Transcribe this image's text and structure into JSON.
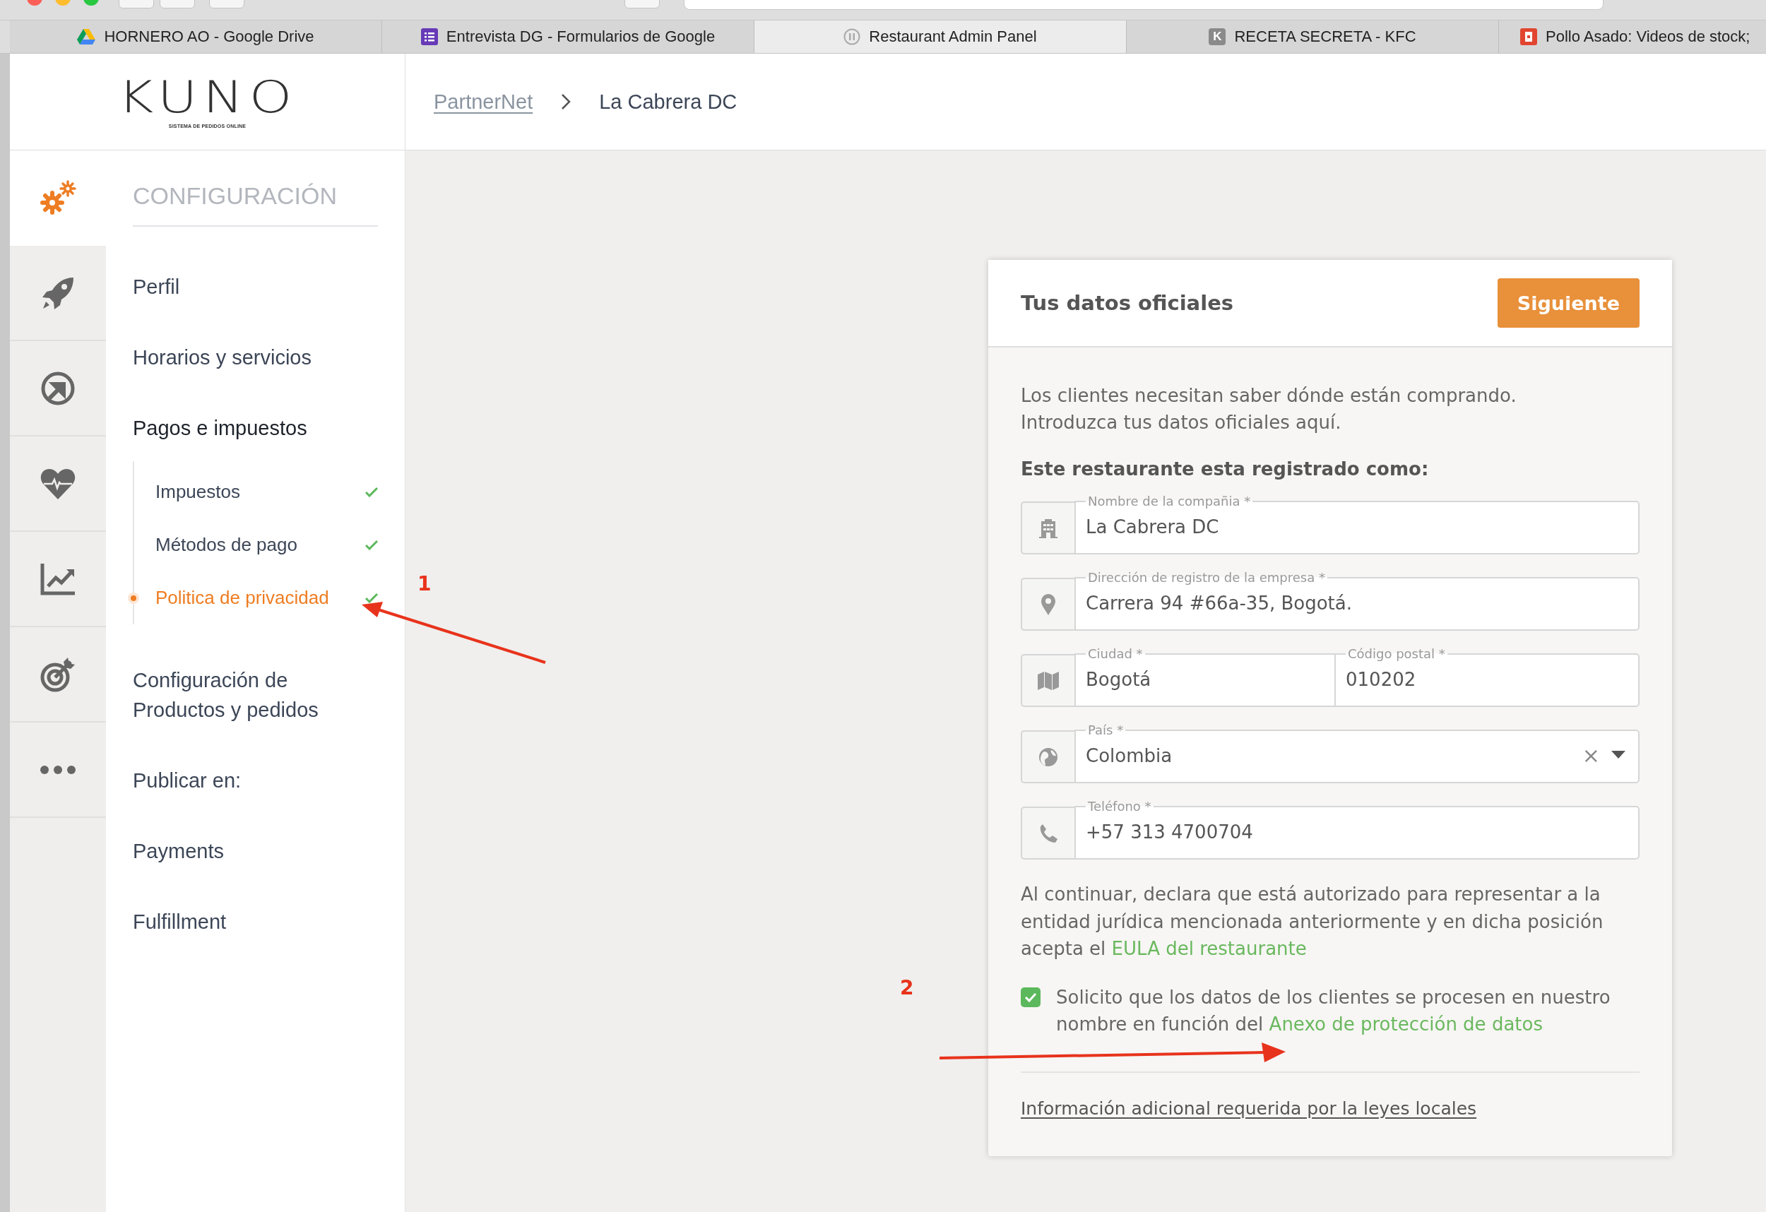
{
  "browser_tabs": [
    {
      "title": "HORNERO AO - Google Drive",
      "kind": "drive",
      "selected": false
    },
    {
      "title": "Entrevista DG - Formularios de Google",
      "kind": "forms",
      "selected": false
    },
    {
      "title": "Restaurant Admin Panel",
      "kind": "pause",
      "selected": true
    },
    {
      "title": "RECETA SECRETA - KFC",
      "kind": "letter",
      "badge": "K",
      "selected": false
    },
    {
      "title": "Pollo Asado: Videos de stock;",
      "kind": "square",
      "selected": false
    }
  ],
  "header": {
    "logo": {
      "wordmark": "KUNO",
      "tagline": "SISTEMA DE PEDIDOS ONLINE"
    },
    "breadcrumb": [
      {
        "label": "PartnerNet",
        "kind": "link"
      },
      {
        "label": "La Cabrera DC",
        "kind": "current"
      }
    ]
  },
  "icon_rail": [
    {
      "kind": "gears",
      "selected": true
    },
    {
      "kind": "rocket",
      "selected": false
    },
    {
      "kind": "arrow-circle",
      "selected": false
    },
    {
      "kind": "heart",
      "selected": false
    },
    {
      "kind": "chart",
      "selected": false
    },
    {
      "kind": "target",
      "selected": false
    },
    {
      "kind": "dots",
      "selected": false
    }
  ],
  "nav": {
    "title": "CONFIGURACIÓN",
    "items": [
      {
        "label": "Perfil",
        "expanded": false
      },
      {
        "label": "Horarios y servicios",
        "expanded": false
      },
      {
        "label": "Pagos e impuestos",
        "expanded": true,
        "children": [
          {
            "label": "Impuestos",
            "selected": false,
            "checked": true
          },
          {
            "label": "Métodos de pago",
            "selected": false,
            "checked": true
          },
          {
            "label": "Politica de privacidad",
            "selected": true,
            "checked": true
          }
        ]
      },
      {
        "label": "Configuración de Productos y pedidos",
        "expanded": false
      },
      {
        "label": "Publicar en:",
        "expanded": false
      },
      {
        "label": "Payments",
        "expanded": false
      },
      {
        "label": "Fulfillment",
        "expanded": false
      }
    ]
  },
  "card": {
    "title": "Tus datos oficiales",
    "button": "Siguiente",
    "intro": [
      "Los clientes necesitan saber dónde están comprando.",
      "Introduzca tus datos oficiales aquí."
    ],
    "section_label": "Este restaurante esta registrado como:",
    "rows": [
      {
        "kind": "text",
        "inputs": [
          {
            "label": "Nombre de la compañia *",
            "value": "La Cabrera DC"
          }
        ]
      },
      {
        "kind": "text",
        "inputs": [
          {
            "label": "Dirección de registro de la empresa *",
            "value": "Carrera 94 #66a-35, Bogotá."
          }
        ]
      },
      {
        "kind": "text",
        "inputs": [
          {
            "label": "Ciudad *",
            "value": "Bogotá"
          },
          {
            "label": "Código postal *",
            "value": "010202"
          }
        ]
      },
      {
        "kind": "select",
        "inputs": [
          {
            "label": "País *",
            "value": "Colombia"
          }
        ],
        "clear": "×"
      },
      {
        "kind": "text",
        "inputs": [
          {
            "label": "Teléfono *",
            "value": "+57 313 4700704"
          }
        ]
      }
    ],
    "legal": {
      "text": "Al continuar, declara que está autorizado para representar a la entidad jurídica mencionada anteriormente y en dicha posición acepta el",
      "link": "EULA del restaurante"
    },
    "consent": {
      "checked": true,
      "text": "Solicito que los datos de los clientes se procesen en nuestro nombre en función del",
      "link": "Anexo de protección de datos"
    },
    "footer_link": "Información adicional requerida por la leyes locales"
  },
  "annotations": [
    {
      "label": "1"
    },
    {
      "label": "2"
    }
  ]
}
